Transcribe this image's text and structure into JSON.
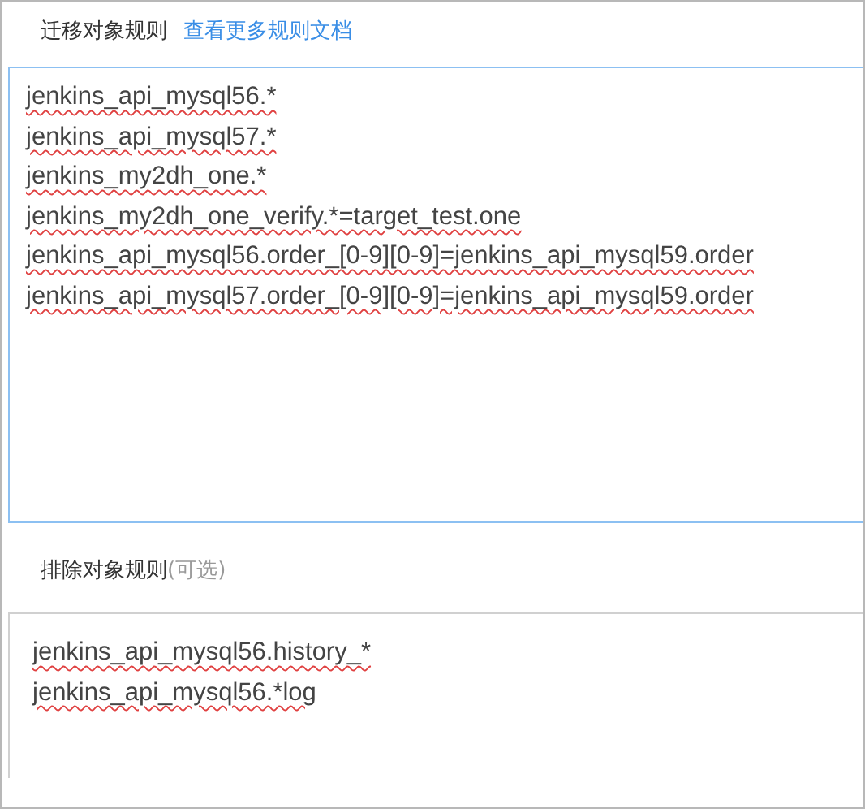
{
  "migrate_rules": {
    "label": "迁移对象规则",
    "link": "查看更多规则文档",
    "focused": true,
    "lines": [
      "jenkins_api_mysql56.*",
      "jenkins_api_mysql57.*",
      "jenkins_my2dh_one.*",
      "jenkins_my2dh_one_verify.*=target_test.one",
      "jenkins_api_mysql56.order_[0-9][0-9]=jenkins_api_mysql59.order",
      "jenkins_api_mysql57.order_[0-9][0-9]=jenkins_api_mysql59.order"
    ]
  },
  "exclude_rules": {
    "label": "排除对象规则",
    "hint": "(可选)",
    "focused": false,
    "lines": [
      "jenkins_api_mysql56.history_*",
      "jenkins_api_mysql56.*log"
    ]
  }
}
